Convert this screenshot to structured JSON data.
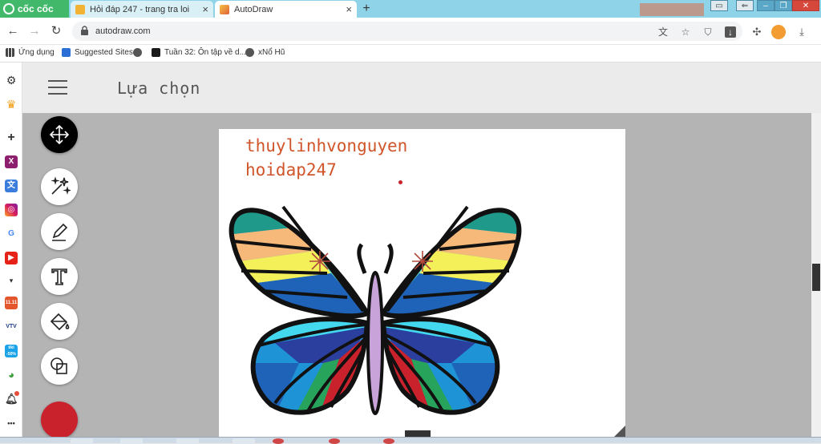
{
  "browser": {
    "brand": "cốc cốc",
    "tabs": [
      {
        "title": "Hỏi đáp 247 - trang tra loi",
        "close": "×"
      },
      {
        "title": "AutoDraw",
        "close": "×"
      }
    ],
    "new_tab": "+",
    "url": "autodraw.com",
    "bookmarks": [
      {
        "label": "Ứng dụng"
      },
      {
        "label": "Suggested Sites"
      },
      {
        "label": ""
      },
      {
        "label": "Tuần 32: Ôn tập về d..."
      },
      {
        "label": "xNổ Hũ"
      }
    ],
    "sidebar_badges": {
      "x": "X",
      "g": "G",
      "sale": "11.11",
      "vtv": "VTV",
      "tiki": "tiki -50%",
      "more": "•••"
    }
  },
  "app": {
    "title": "Lựa chọn",
    "tools": [
      {
        "name": "select",
        "active": true
      },
      {
        "name": "autodraw",
        "active": false
      },
      {
        "name": "draw",
        "active": false
      },
      {
        "name": "type",
        "active": false
      },
      {
        "name": "fill",
        "active": false
      },
      {
        "name": "shape",
        "active": false
      }
    ],
    "current_color": "#c9222d",
    "canvas_text": [
      "thuylinhvonguyen",
      "hoidap247"
    ],
    "text_color": "#d0552a"
  },
  "colors": {
    "tabstrip": "#8fd3e8",
    "brand": "#41b86a",
    "workspace": "#b4b4b4"
  }
}
